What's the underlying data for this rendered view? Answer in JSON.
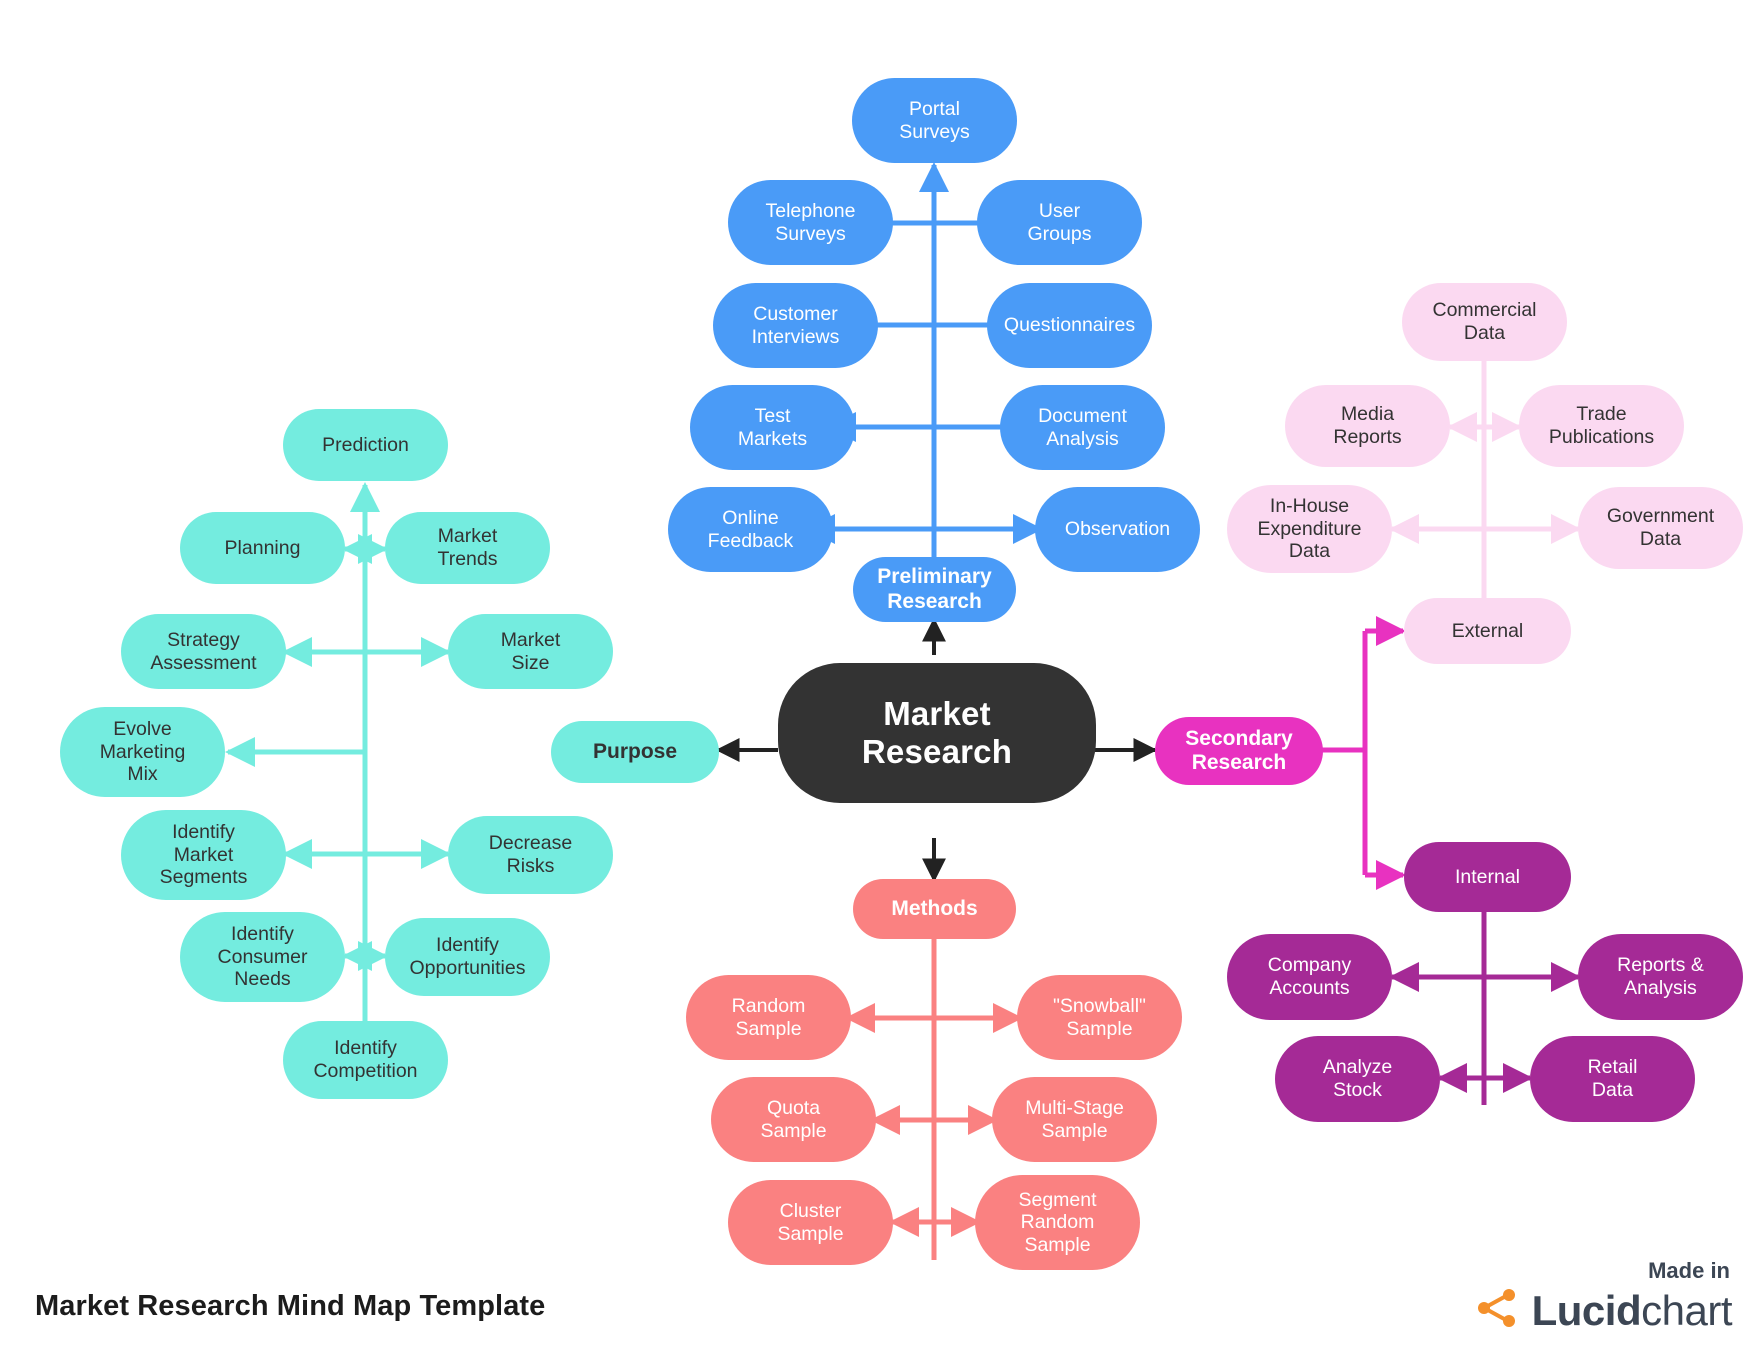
{
  "footer": {
    "title": "Market Research Mind Map Template",
    "made_in": "Made in",
    "brand_bold": "Lucid",
    "brand_light": "chart"
  },
  "colors": {
    "root": "#333333",
    "root_text": "#ffffff",
    "preliminary": "#4a9bf7",
    "preliminary_text": "#ffffff",
    "purpose": "#74ecdf",
    "purpose_text": "#333333",
    "methods": "#fa8181",
    "methods_text": "#ffffff",
    "secondary": "#e832c0",
    "secondary_text": "#ffffff",
    "external": "#fbd9f1",
    "external_text": "#333333",
    "internal": "#a52a96",
    "internal_text": "#ffffff"
  },
  "root": {
    "label": "Market\nResearch"
  },
  "branches": {
    "preliminary_research": {
      "label": "Preliminary\nResearch"
    },
    "purpose": {
      "label": "Purpose"
    },
    "methods": {
      "label": "Methods"
    },
    "secondary_research": {
      "label": "Secondary\nResearch"
    },
    "external": {
      "label": "External"
    },
    "internal": {
      "label": "Internal"
    }
  },
  "preliminary_nodes": [
    {
      "label": "Portal\nSurveys"
    },
    {
      "label": "Telephone\nSurveys"
    },
    {
      "label": "User\nGroups"
    },
    {
      "label": "Customer\nInterviews"
    },
    {
      "label": "Questionnaires"
    },
    {
      "label": "Test\nMarkets"
    },
    {
      "label": "Document\nAnalysis"
    },
    {
      "label": "Online\nFeedback"
    },
    {
      "label": "Observation"
    }
  ],
  "purpose_nodes": [
    {
      "label": "Prediction"
    },
    {
      "label": "Planning"
    },
    {
      "label": "Market\nTrends"
    },
    {
      "label": "Strategy\nAssessment"
    },
    {
      "label": "Market\nSize"
    },
    {
      "label": "Evolve\nMarketing\nMix"
    },
    {
      "label": "Identify\nMarket\nSegments"
    },
    {
      "label": "Decrease\nRisks"
    },
    {
      "label": "Identify\nConsumer\nNeeds"
    },
    {
      "label": "Identify\nOpportunities"
    },
    {
      "label": "Identify\nCompetition"
    }
  ],
  "methods_nodes": [
    {
      "label": "Random\nSample"
    },
    {
      "label": "\"Snowball\"\nSample"
    },
    {
      "label": "Quota\nSample"
    },
    {
      "label": "Multi-Stage\nSample"
    },
    {
      "label": "Cluster\nSample"
    },
    {
      "label": "Segment\nRandom\nSample"
    }
  ],
  "external_nodes": [
    {
      "label": "Commercial\nData"
    },
    {
      "label": "Media\nReports"
    },
    {
      "label": "Trade\nPublications"
    },
    {
      "label": "In-House\nExpenditure\nData"
    },
    {
      "label": "Government\nData"
    }
  ],
  "internal_nodes": [
    {
      "label": "Company\nAccounts"
    },
    {
      "label": "Reports &\nAnalysis"
    },
    {
      "label": "Analyze\nStock"
    },
    {
      "label": "Retail\nData"
    }
  ]
}
